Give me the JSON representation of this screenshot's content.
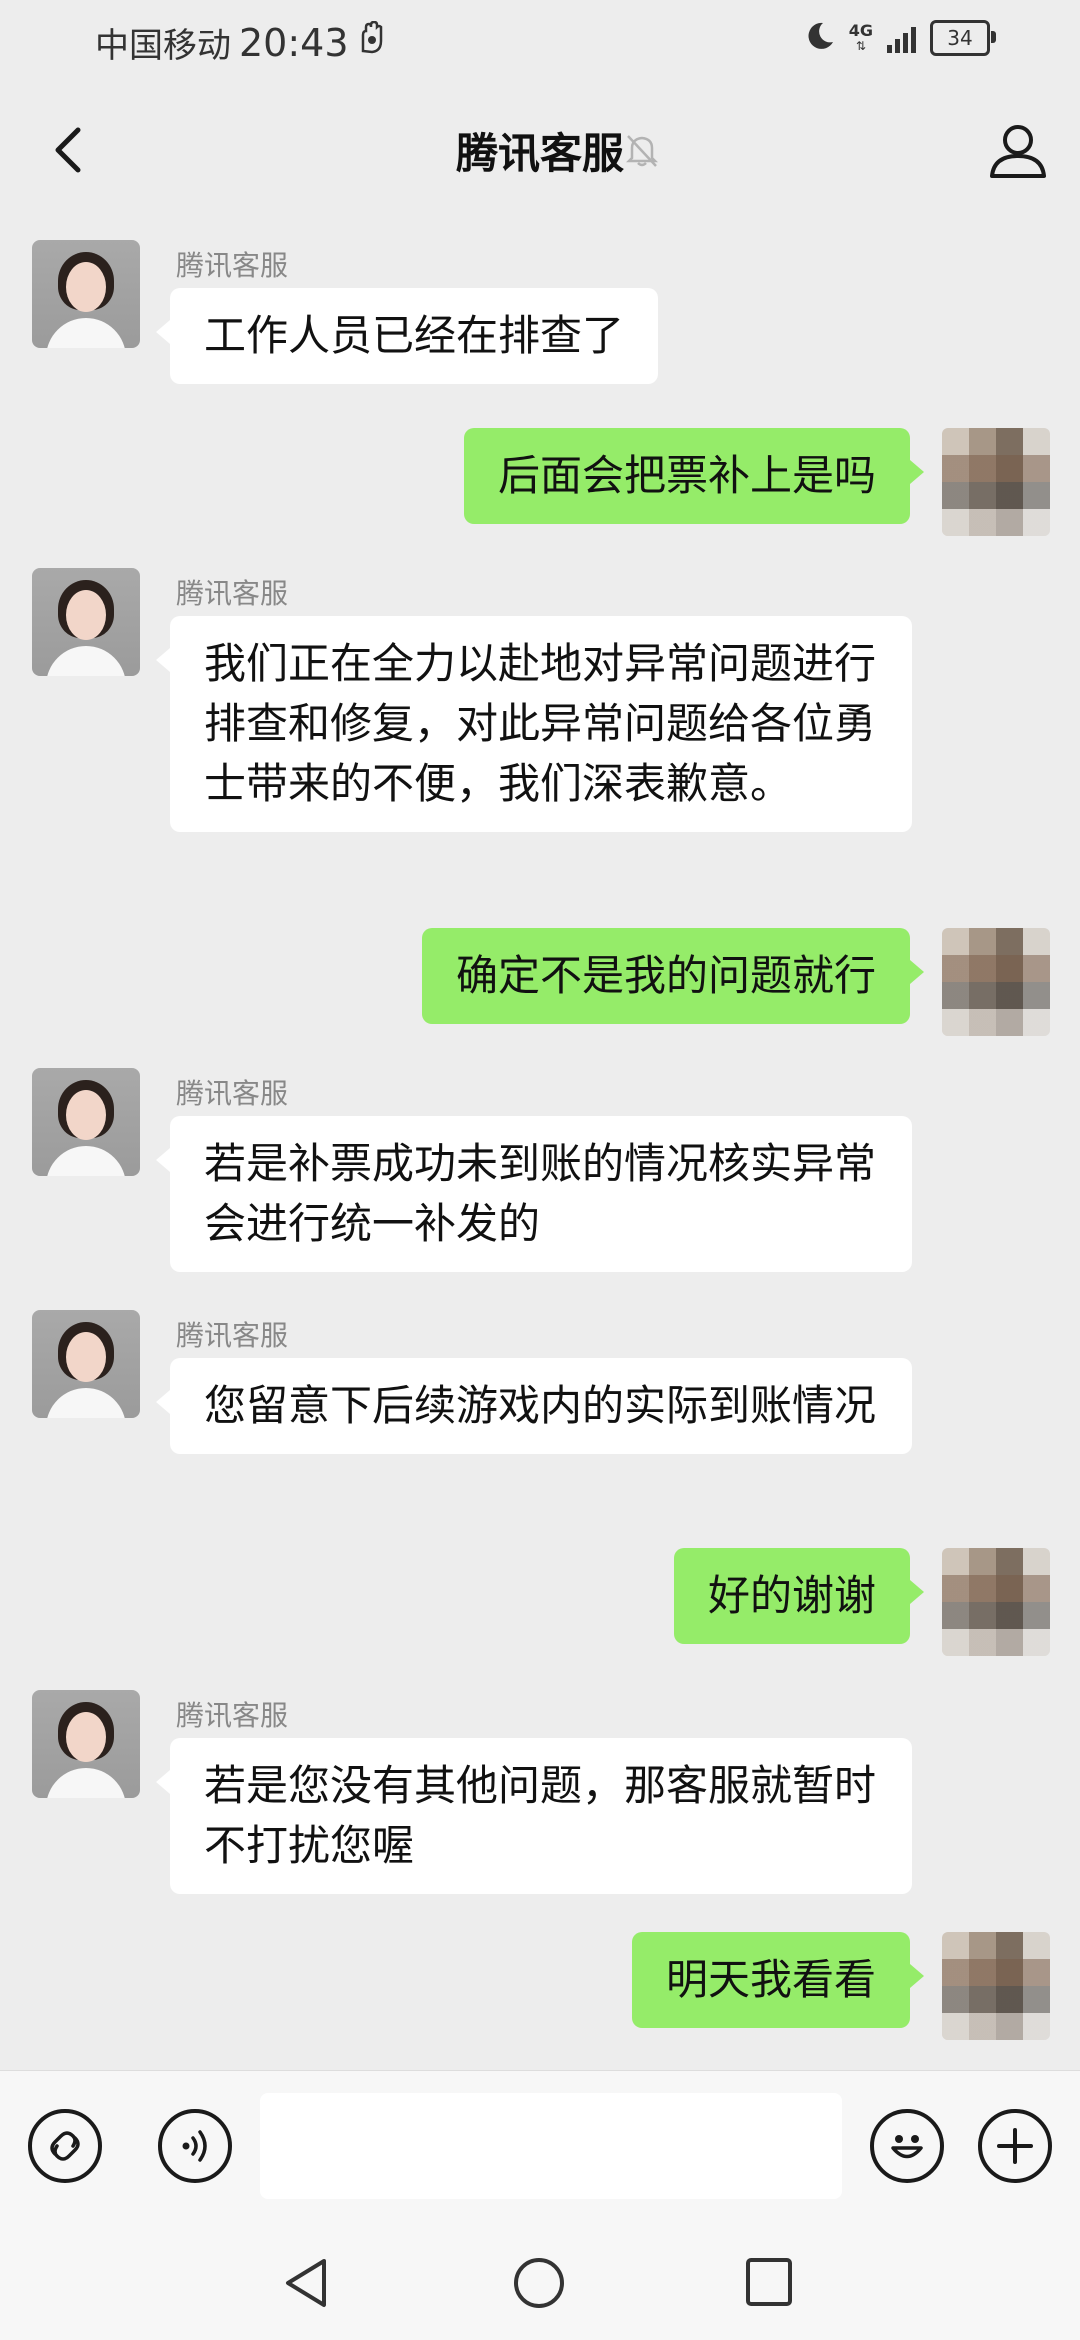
{
  "status_bar": {
    "carrier": "中国移动",
    "time": "20:43",
    "network_label": "4G",
    "battery": "34"
  },
  "header": {
    "title": "腾讯客服"
  },
  "messages": [
    {
      "side": "in",
      "sender": "腾讯客服",
      "text": "工作人员已经在排查了"
    },
    {
      "side": "out",
      "text": "后面会把票补上是吗"
    },
    {
      "side": "in",
      "sender": "腾讯客服",
      "text": "我们正在全力以赴地对异常问题进行排查和修复，对此异常问题给各位勇士带来的不便，我们深表歉意。"
    },
    {
      "side": "out",
      "text": "确定不是我的问题就行"
    },
    {
      "side": "in",
      "sender": "腾讯客服",
      "text": "若是补票成功未到账的情况核实异常会进行统一补发的"
    },
    {
      "side": "in",
      "sender": "腾讯客服",
      "text": "您留意下后续游戏内的实际到账情况"
    },
    {
      "side": "out",
      "text": "好的谢谢"
    },
    {
      "side": "in",
      "sender": "腾讯客服",
      "text": "若是您没有其他问题，那客服就暂时不打扰您喔"
    },
    {
      "side": "out",
      "text": "明天我看看"
    }
  ],
  "input": {
    "value": "",
    "icons": [
      "mini-program-icon",
      "voice-icon",
      "emoji-icon",
      "plus-icon"
    ]
  },
  "nav": {
    "icons": [
      "back-triangle-icon",
      "home-circle-icon",
      "recents-square-icon"
    ]
  }
}
